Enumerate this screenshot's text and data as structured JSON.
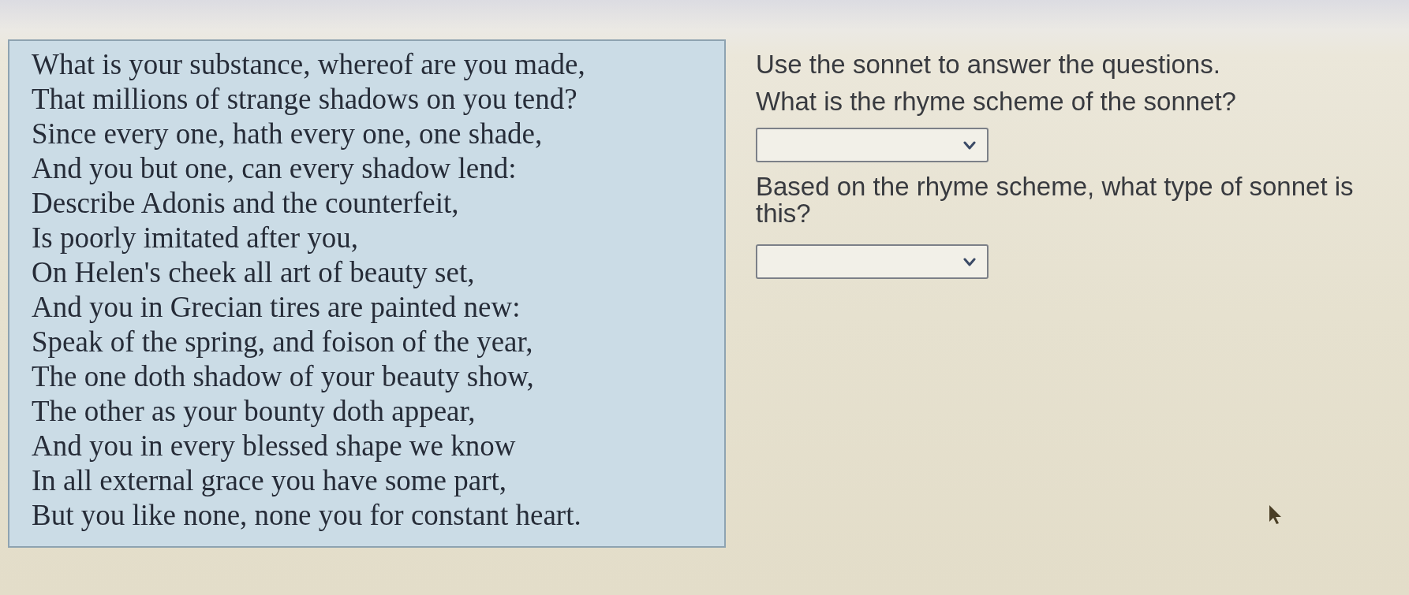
{
  "passage": {
    "lines": [
      "What is your substance, whereof are you made,",
      "That millions of strange shadows on you tend?",
      "Since every one, hath every one, one shade,",
      "And you but one, can every shadow lend:",
      "Describe Adonis and the counterfeit,",
      "Is poorly imitated after you,",
      "On Helen's cheek all art of beauty set,",
      "And you in Grecian tires are painted new:",
      "Speak of the spring, and foison of the year,",
      "The one doth shadow of your beauty show,",
      "The other as your bounty doth appear,",
      "And you in every blessed shape we know",
      "In all external grace you have some part,",
      "But you like none, none you for constant heart."
    ]
  },
  "questions": {
    "instructions": "Use the sonnet to answer the questions.",
    "items": [
      {
        "prompt": "What is the rhyme scheme of the sonnet?",
        "kind": "dropdown"
      },
      {
        "prompt": "Based on the rhyme scheme, what type of sonnet is this?",
        "kind": "dropdown"
      }
    ]
  }
}
